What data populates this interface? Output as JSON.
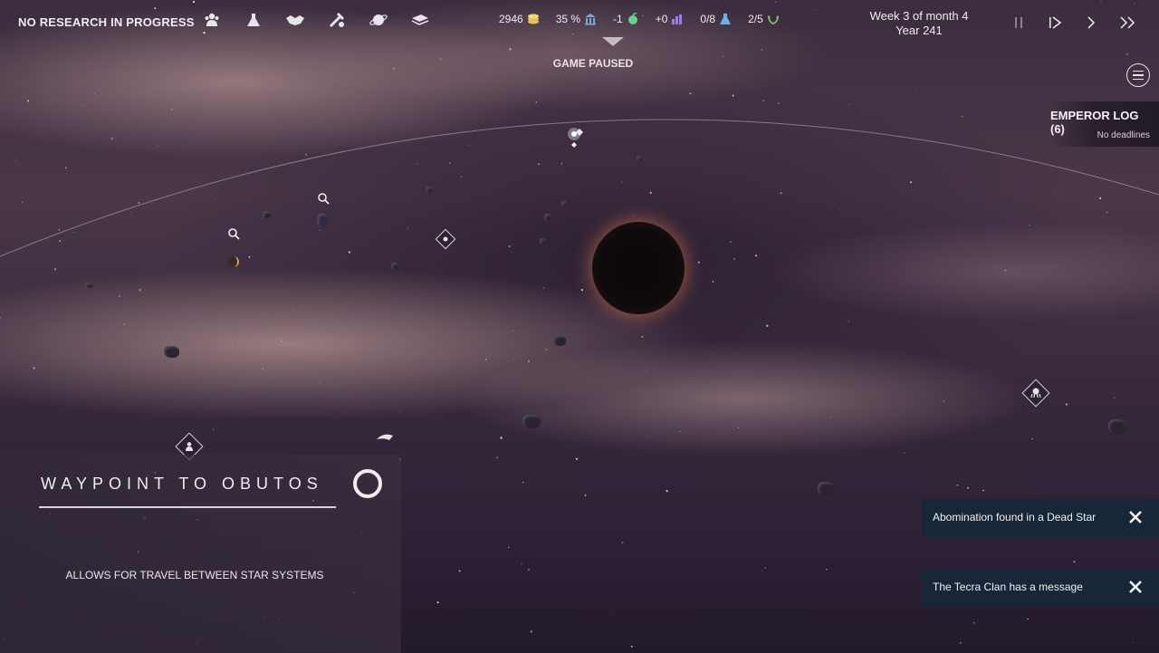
{
  "topbar": {
    "research_status": "NO RESEARCH IN PROGRESS",
    "menu_icons": [
      "population-icon",
      "science-flask-icon",
      "diplomacy-handshake-icon",
      "tools-icon",
      "planet-icon",
      "book-icon"
    ],
    "resources": [
      {
        "value": "2946",
        "icon": "credits-icon",
        "color": "#e3c25a"
      },
      {
        "value": "35 %",
        "icon": "approval-building-icon",
        "color": "#7fa8d8"
      },
      {
        "value": "-1",
        "icon": "food-icon",
        "color": "#6fd08a"
      },
      {
        "value": "+0",
        "icon": "industry-icon",
        "color": "#a080d8"
      },
      {
        "value": "0/8",
        "icon": "research-flask-icon",
        "color": "#6fb0e0"
      },
      {
        "value": "2/5",
        "icon": "influence-laurel-icon",
        "color": "#7fbf6a"
      }
    ],
    "date_line1": "Week 3 of month 4",
    "date_line2": "Year 241",
    "speed_controls": [
      "pause",
      "play",
      "fast",
      "fastest"
    ]
  },
  "status": {
    "paused": "GAME PAUSED"
  },
  "emperor_log": {
    "title": "EMPEROR LOG (6)",
    "subtitle": "No deadlines"
  },
  "waypoint": {
    "title": "WAYPOINT TO OBUTOS",
    "description": "ALLOWS FOR TRAVEL BETWEEN STAR SYSTEMS"
  },
  "notifications": [
    {
      "text": "Abomination found in a Dead Star"
    },
    {
      "text": "The Tecra Clan has a message"
    }
  ],
  "colors": {
    "accent": "#f0ecf0",
    "notification_bg": "#162838",
    "panel_bg": "#3a3040",
    "blackhole_glow": "#ff9a55"
  }
}
